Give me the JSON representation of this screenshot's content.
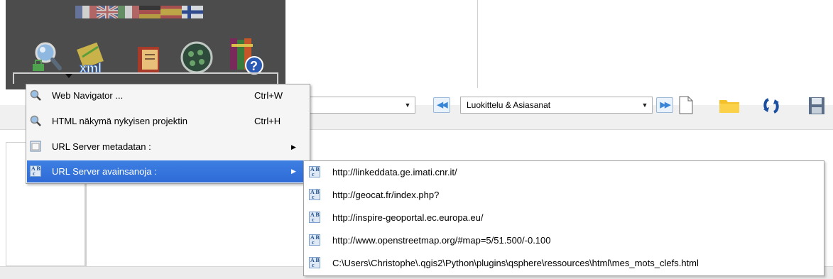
{
  "menu": {
    "items": [
      {
        "label": "Web Navigator ...",
        "shortcut": "Ctrl+W",
        "icon": "magnifier-globe-icon"
      },
      {
        "label": "HTML näkymä nykyisen projektin",
        "shortcut": "Ctrl+H",
        "icon": "magnifier-globe-icon"
      },
      {
        "label": "URL Server metadatan :",
        "shortcut": "",
        "icon": "window-icon"
      },
      {
        "label": "URL Server avainsanoja :",
        "shortcut": "",
        "icon": "abc-icon"
      }
    ]
  },
  "submenu": {
    "items": [
      {
        "label": "http://linkeddata.ge.imati.cnr.it/"
      },
      {
        "label": "http://geocat.fr/index.php?"
      },
      {
        "label": "http://inspire-geoportal.ec.europa.eu/"
      },
      {
        "label": "http://www.openstreetmap.org/#map=5/51.500/-0.100"
      },
      {
        "label": "C:\\Users\\Christophe\\.qgis2\\Python\\plugins\\qsphere\\ressources\\html\\mes_mots_clefs.html"
      }
    ]
  },
  "toolbar": {
    "thesaurus_combo": "Luokittelu & Asiasanat",
    "icons": [
      "search-globe-icon",
      "xml-icon",
      "book-icon",
      "database-icon",
      "help-books-icon"
    ],
    "right_icons": [
      "previous-icon",
      "next-icon",
      "new-document-icon",
      "open-folder-icon",
      "refresh-icon",
      "save-icon"
    ],
    "flags": [
      "fr-flag-icon",
      "uk-flag-icon",
      "it-flag-icon",
      "de-flag-icon",
      "es-flag-icon",
      "fi-flag-icon"
    ]
  },
  "colors": {
    "highlight": "#2f6bd6",
    "dark_panel": "#4c4c4c"
  }
}
